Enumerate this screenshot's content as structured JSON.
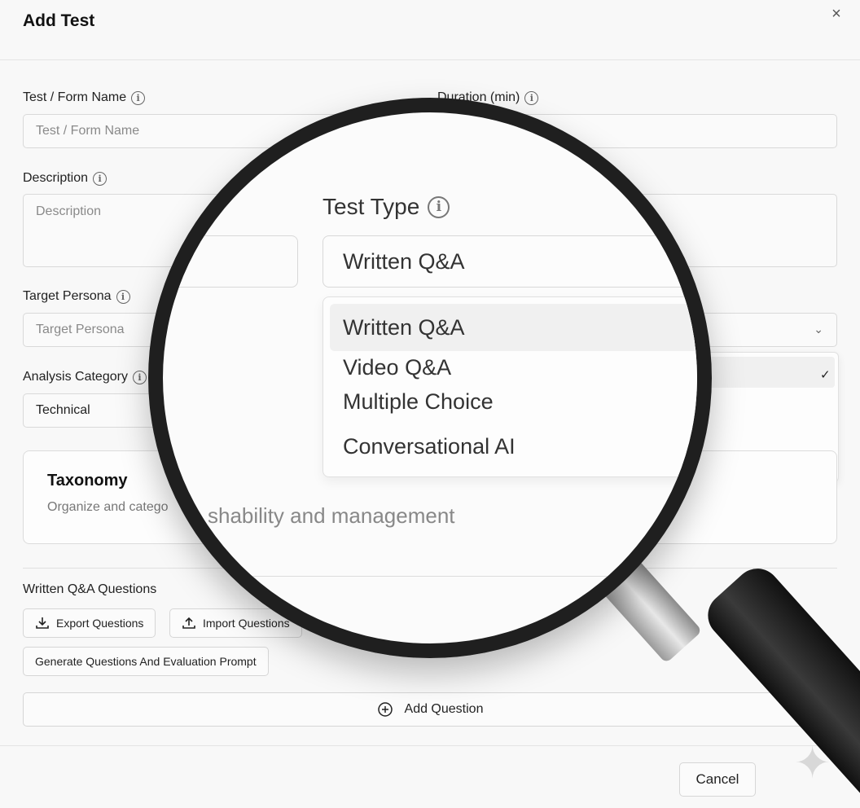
{
  "dialog": {
    "title": "Add Test",
    "close_icon": "×"
  },
  "form": {
    "name_label": "Test / Form Name",
    "name_placeholder": "Test / Form Name",
    "duration_label": "Duration (min)",
    "description_label": "Description",
    "description_placeholder": "Description",
    "persona_label": "Target Persona",
    "persona_placeholder": "Target Persona",
    "category_label": "Analysis Category",
    "category_value": "Technical"
  },
  "taxonomy": {
    "title": "Taxonomy",
    "description_visible": "Organize and catego",
    "description_zoomed": "shability and management"
  },
  "questions": {
    "section_title": "Written Q&A Questions",
    "export_label": "Export Questions",
    "import_label": "Import Questions",
    "generate_label": "Generate Questions And Evaluation Prompt",
    "add_label": "Add Question"
  },
  "footer": {
    "cancel_label": "Cancel"
  },
  "test_type": {
    "label": "Test Type",
    "selected": "Written Q&A",
    "options": [
      "Written Q&A",
      "Video Q&A",
      "Multiple Choice",
      "Conversational AI"
    ]
  },
  "icons": {
    "info": "info-icon",
    "chevron": "chevron-down-icon",
    "check": "check-icon",
    "download": "download-icon",
    "upload": "upload-icon",
    "plus_circle": "plus-circle-icon"
  }
}
